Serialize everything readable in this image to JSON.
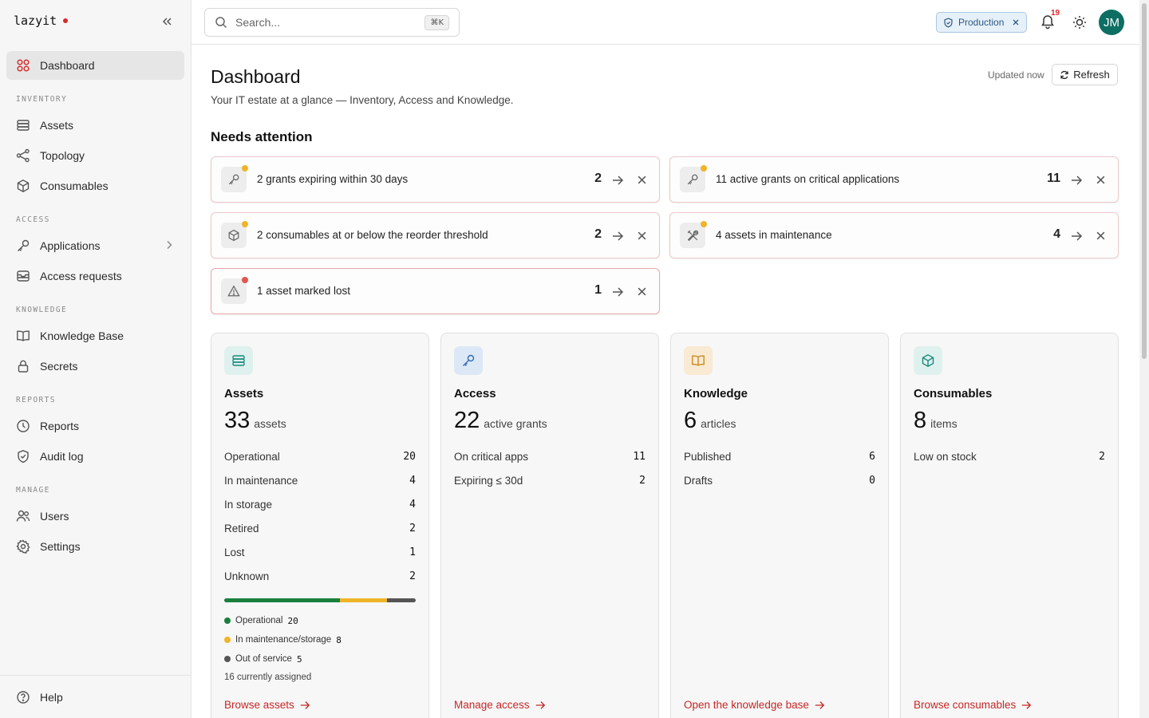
{
  "brand": {
    "name": "lazyit"
  },
  "sidebar": {
    "items": [
      {
        "label": "Dashboard"
      },
      {
        "label": "Assets"
      },
      {
        "label": "Topology"
      },
      {
        "label": "Consumables"
      },
      {
        "label": "Applications"
      },
      {
        "label": "Access requests"
      },
      {
        "label": "Knowledge Base"
      },
      {
        "label": "Secrets"
      },
      {
        "label": "Reports"
      },
      {
        "label": "Audit log"
      },
      {
        "label": "Users"
      },
      {
        "label": "Settings"
      }
    ],
    "sections": [
      "INVENTORY",
      "ACCESS",
      "KNOWLEDGE",
      "REPORTS",
      "MANAGE"
    ],
    "footer": {
      "label": "Help"
    }
  },
  "topbar": {
    "search_placeholder": "Search...",
    "shortcut": "⌘K",
    "environment": "Production",
    "notification_count": "19",
    "avatar_initials": "JM"
  },
  "page": {
    "title": "Dashboard",
    "subtitle": "Your IT estate at a glance — Inventory, Access and Knowledge.",
    "updated": "Updated now",
    "refresh_label": "Refresh",
    "attention_title": "Needs attention"
  },
  "alerts": [
    {
      "text": "2 grants expiring within 30 days",
      "count": "2",
      "icon": "key-icon",
      "severity": "warning"
    },
    {
      "text": "11 active grants on critical applications",
      "count": "11",
      "icon": "key-icon",
      "severity": "warning"
    },
    {
      "text": "2 consumables at or below the reorder threshold",
      "count": "2",
      "icon": "box-icon",
      "severity": "warning"
    },
    {
      "text": "4 assets in maintenance",
      "count": "4",
      "icon": "tools-icon",
      "severity": "warning"
    },
    {
      "text": "1 asset marked lost",
      "count": "1",
      "icon": "warning-icon",
      "severity": "danger"
    }
  ],
  "cards": {
    "assets": {
      "title": "Assets",
      "count": "33",
      "unit": "assets",
      "rows": [
        {
          "label": "Operational",
          "value": "20"
        },
        {
          "label": "In maintenance",
          "value": "4"
        },
        {
          "label": "In storage",
          "value": "4"
        },
        {
          "label": "Retired",
          "value": "2"
        },
        {
          "label": "Lost",
          "value": "1"
        },
        {
          "label": "Unknown",
          "value": "2"
        }
      ],
      "legend": [
        {
          "label": "Operational",
          "value": "20",
          "color": "#1a7f3c"
        },
        {
          "label": "In maintenance/storage",
          "value": "8",
          "color": "#f0b429"
        },
        {
          "label": "Out of service",
          "value": "5",
          "color": "#555555"
        }
      ],
      "assigned": "16 currently assigned",
      "link": "Browse assets"
    },
    "access": {
      "title": "Access",
      "count": "22",
      "unit": "active grants",
      "rows": [
        {
          "label": "On critical apps",
          "value": "11"
        },
        {
          "label": "Expiring ≤ 30d",
          "value": "2"
        }
      ],
      "link": "Manage access"
    },
    "knowledge": {
      "title": "Knowledge",
      "count": "6",
      "unit": "articles",
      "rows": [
        {
          "label": "Published",
          "value": "6"
        },
        {
          "label": "Drafts",
          "value": "0"
        }
      ],
      "link": "Open the knowledge base"
    },
    "consumables": {
      "title": "Consumables",
      "count": "8",
      "unit": "items",
      "rows": [
        {
          "label": "Low on stock",
          "value": "2"
        }
      ],
      "link": "Browse consumables"
    }
  },
  "colors": {
    "accent": "#d62b2b",
    "link": "#c62828",
    "warning": "#f0b429",
    "danger": "#e0574f"
  }
}
